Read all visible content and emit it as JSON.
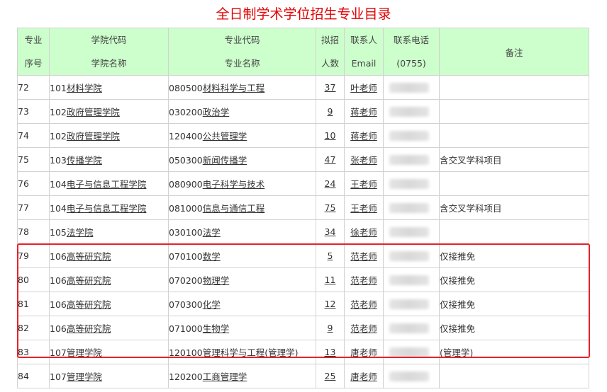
{
  "title": "全日制学术学位招生专业目录",
  "header": {
    "no": [
      "专业",
      "序号"
    ],
    "college": [
      "学院代码",
      "学院名称"
    ],
    "major": [
      "专业代码",
      "专业名称"
    ],
    "quota": [
      "拟招",
      "人数"
    ],
    "contact": [
      "联系人",
      "Email"
    ],
    "phone": [
      "联系电话",
      "(0755)"
    ],
    "note": "备注"
  },
  "rows": [
    {
      "no": "72",
      "college_code": "101",
      "college_name": "材料学院",
      "major_code": "080500",
      "major_name": "材料科学与工程",
      "major_suffix": "",
      "quota": "37",
      "contact": "叶老师",
      "note": ""
    },
    {
      "no": "73",
      "college_code": "102",
      "college_name": "政府管理学院",
      "major_code": "030200",
      "major_name": "政治学",
      "major_suffix": "",
      "quota": "9",
      "contact": "蒋老师",
      "note": ""
    },
    {
      "no": "74",
      "college_code": "102",
      "college_name": "政府管理学院",
      "major_code": "120400",
      "major_name": "公共管理学",
      "major_suffix": "",
      "quota": "10",
      "contact": "蒋老师",
      "note": ""
    },
    {
      "no": "75",
      "college_code": "103",
      "college_name": "传播学院",
      "major_code": "050300",
      "major_name": "新闻传播学",
      "major_suffix": "",
      "quota": "47",
      "contact": "张老师",
      "note": "含交叉学科项目"
    },
    {
      "no": "76",
      "college_code": "104",
      "college_name": "电子与信息工程学院",
      "major_code": "080900",
      "major_name": "电子科学与技术",
      "major_suffix": "",
      "quota": "24",
      "contact": "王老师",
      "note": ""
    },
    {
      "no": "77",
      "college_code": "104",
      "college_name": "电子与信息工程学院",
      "major_code": "081000",
      "major_name": "信息与通信工程",
      "major_suffix": "",
      "quota": "75",
      "contact": "王老师",
      "note": "含交叉学科项目"
    },
    {
      "no": "78",
      "college_code": "105",
      "college_name": "法学院",
      "major_code": "030100",
      "major_name": "法学",
      "major_suffix": "",
      "quota": "34",
      "contact": "徐老师",
      "note": ""
    },
    {
      "no": "79",
      "college_code": "106",
      "college_name": "高等研究院",
      "major_code": "070100",
      "major_name": "数学",
      "major_suffix": "",
      "quota": "5",
      "contact": "范老师",
      "note": "仅接推免"
    },
    {
      "no": "80",
      "college_code": "106",
      "college_name": "高等研究院",
      "major_code": "070200",
      "major_name": "物理学",
      "major_suffix": "",
      "quota": "11",
      "contact": "范老师",
      "note": "仅接推免"
    },
    {
      "no": "81",
      "college_code": "106",
      "college_name": "高等研究院",
      "major_code": "070300",
      "major_name": "化学",
      "major_suffix": "",
      "quota": "12",
      "contact": "范老师",
      "note": "仅接推免"
    },
    {
      "no": "82",
      "college_code": "106",
      "college_name": "高等研究院",
      "major_code": "071000",
      "major_name": "生物学",
      "major_suffix": "",
      "quota": "9",
      "contact": "范老师",
      "note": "仅接推免"
    },
    {
      "no": "83",
      "college_code": "107",
      "college_name": "管理学院",
      "major_code": "120100",
      "major_name": "管理科学与工程",
      "major_suffix": "(管理学)",
      "quota": "13",
      "contact": "唐老师",
      "note": "(管理学)"
    },
    {
      "no": "84",
      "college_code": "107",
      "college_name": "管理学院",
      "major_code": "120200",
      "major_name": "工商管理学",
      "major_suffix": "",
      "quota": "25",
      "contact": "唐老师",
      "note": ""
    }
  ]
}
